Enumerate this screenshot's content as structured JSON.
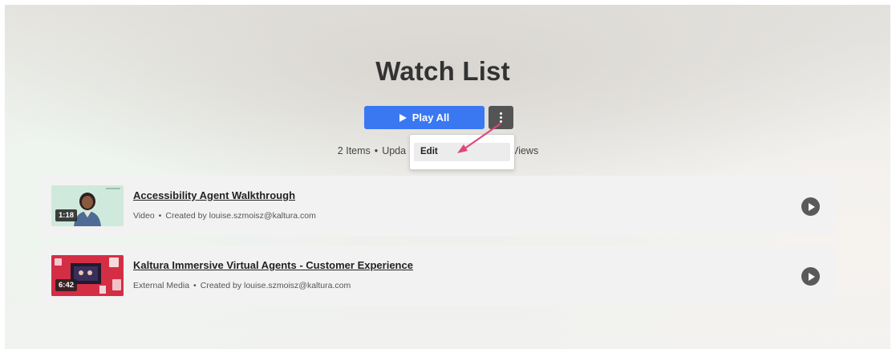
{
  "page": {
    "title": "Watch List"
  },
  "actions": {
    "play_all_label": "Play All",
    "more_icon": "vertical-ellipsis-icon"
  },
  "meta": {
    "items_count": "2 Items",
    "updated_partial": "Upda",
    "views_partial": "Views"
  },
  "menu": {
    "items": [
      {
        "label": "Edit"
      }
    ]
  },
  "annotation": {
    "color": "#e0457b"
  },
  "colors": {
    "primary": "#3a78f2",
    "more_button": "#545454",
    "row_background": "#f2f2f2"
  },
  "items": [
    {
      "title": "Accessibility Agent Walkthrough",
      "type": "Video",
      "created_by": "Created by louise.szmoisz@kaltura.com",
      "duration": "1:18"
    },
    {
      "title": "Kaltura Immersive Virtual Agents - Customer Experience",
      "type": "External Media",
      "created_by": "Created by louise.szmoisz@kaltura.com",
      "duration": "6:42"
    }
  ]
}
